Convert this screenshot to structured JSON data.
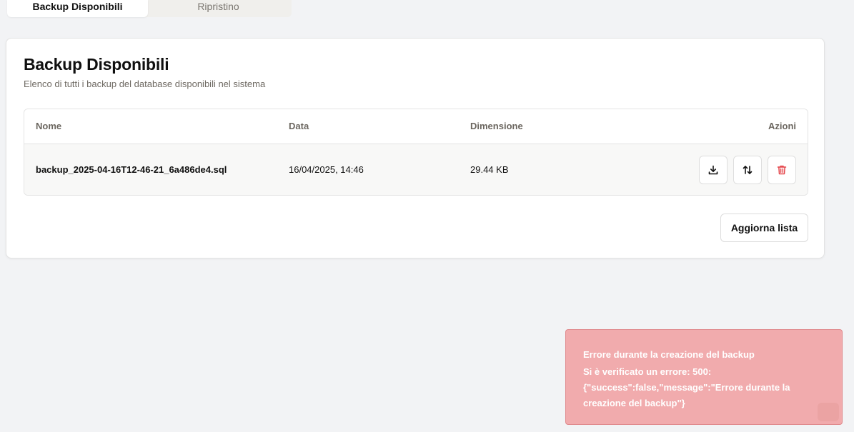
{
  "tabs": [
    {
      "label": "Backup Disponibili",
      "active": true
    },
    {
      "label": "Ripristino",
      "active": false
    }
  ],
  "card": {
    "title": "Backup Disponibili",
    "subtitle": "Elenco di tutti i backup del database disponibili nel sistema"
  },
  "table": {
    "headers": {
      "name": "Nome",
      "date": "Data",
      "size": "Dimensione",
      "actions": "Azioni"
    },
    "rows": [
      {
        "name": "backup_2025-04-16T12-46-21_6a486de4.sql",
        "date": "16/04/2025, 14:46",
        "size": "29.44 KB"
      }
    ],
    "action_icons": [
      "download-icon",
      "restore-arrows-icon",
      "trash-icon"
    ]
  },
  "refresh_label": "Aggiorna lista",
  "toast": {
    "title": "Errore durante la creazione del backup",
    "message": "Si è verificato un errore: 500: {\"success\":false,\"message\":\"Errore durante la creazione del backup\"}"
  },
  "colors": {
    "page_bg": "#f2f3f5",
    "toast_bg": "#f1abad",
    "delete_red": "#e5484d"
  }
}
